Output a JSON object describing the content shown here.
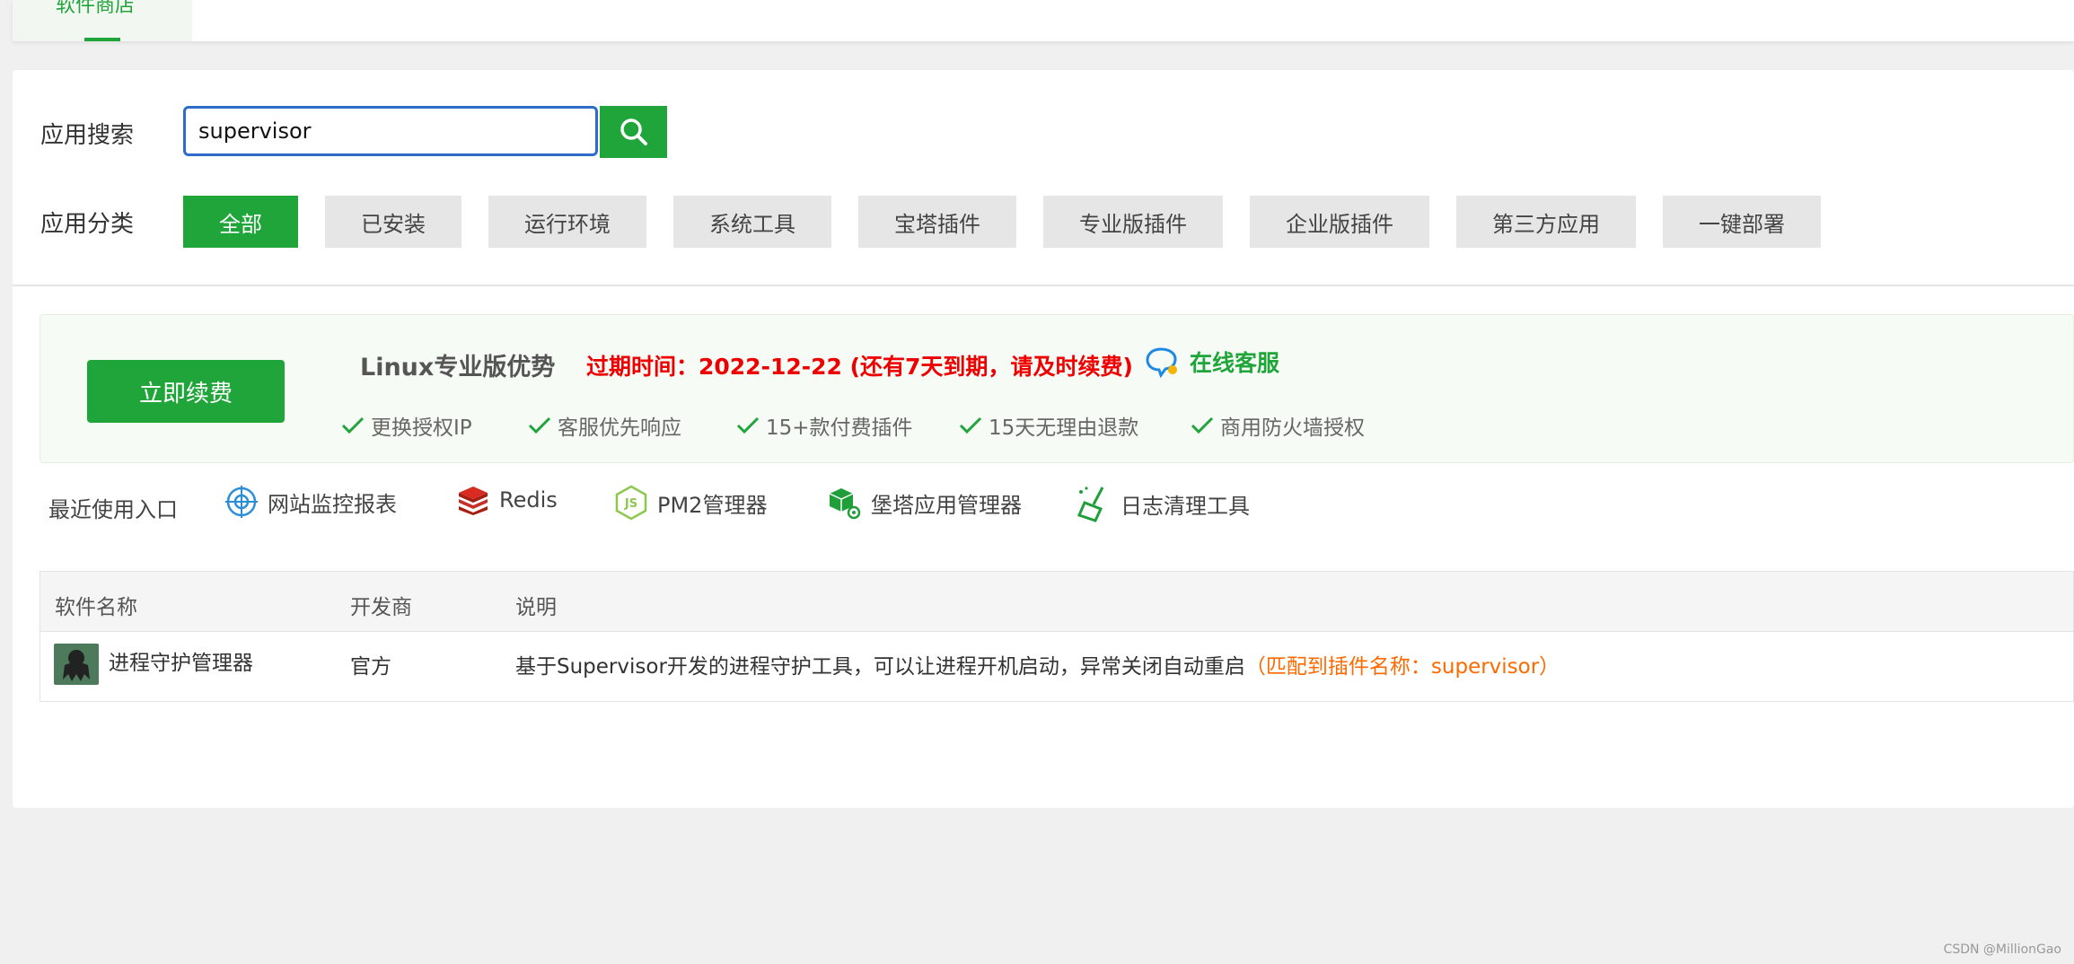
{
  "top_tab": {
    "label": "软件商店"
  },
  "search": {
    "label": "应用搜索",
    "value": "supervisor"
  },
  "categories": {
    "label": "应用分类",
    "items": [
      "全部",
      "已安装",
      "运行环境",
      "系统工具",
      "宝塔插件",
      "专业版插件",
      "企业版插件",
      "第三方应用",
      "一键部署"
    ],
    "active": "全部"
  },
  "promo": {
    "renew_label": "立即续费",
    "title": "Linux专业版优势",
    "expire": "过期时间：2022-12-22 (还有7天到期，请及时续费)",
    "service": "在线客服",
    "features": [
      "更换授权IP",
      "客服优先响应",
      "15+款付费插件",
      "15天无理由退款",
      "商用防火墙授权"
    ]
  },
  "recent": {
    "label": "最近使用入口",
    "items": [
      "网站监控报表",
      "Redis",
      "PM2管理器",
      "堡塔应用管理器",
      "日志清理工具"
    ]
  },
  "table": {
    "headers": [
      "软件名称",
      "开发商",
      "说明"
    ],
    "rows": [
      {
        "name": "进程守护管理器",
        "developer": "官方",
        "description": "基于Supervisor开发的进程守护工具，可以让进程开机启动，异常关闭自动重启",
        "match": "（匹配到插件名称：supervisor）"
      }
    ]
  },
  "watermark": "CSDN @MillionGao",
  "colors": {
    "accent": "#20a53a",
    "warning": "#e00000",
    "match": "#ff6a00"
  }
}
